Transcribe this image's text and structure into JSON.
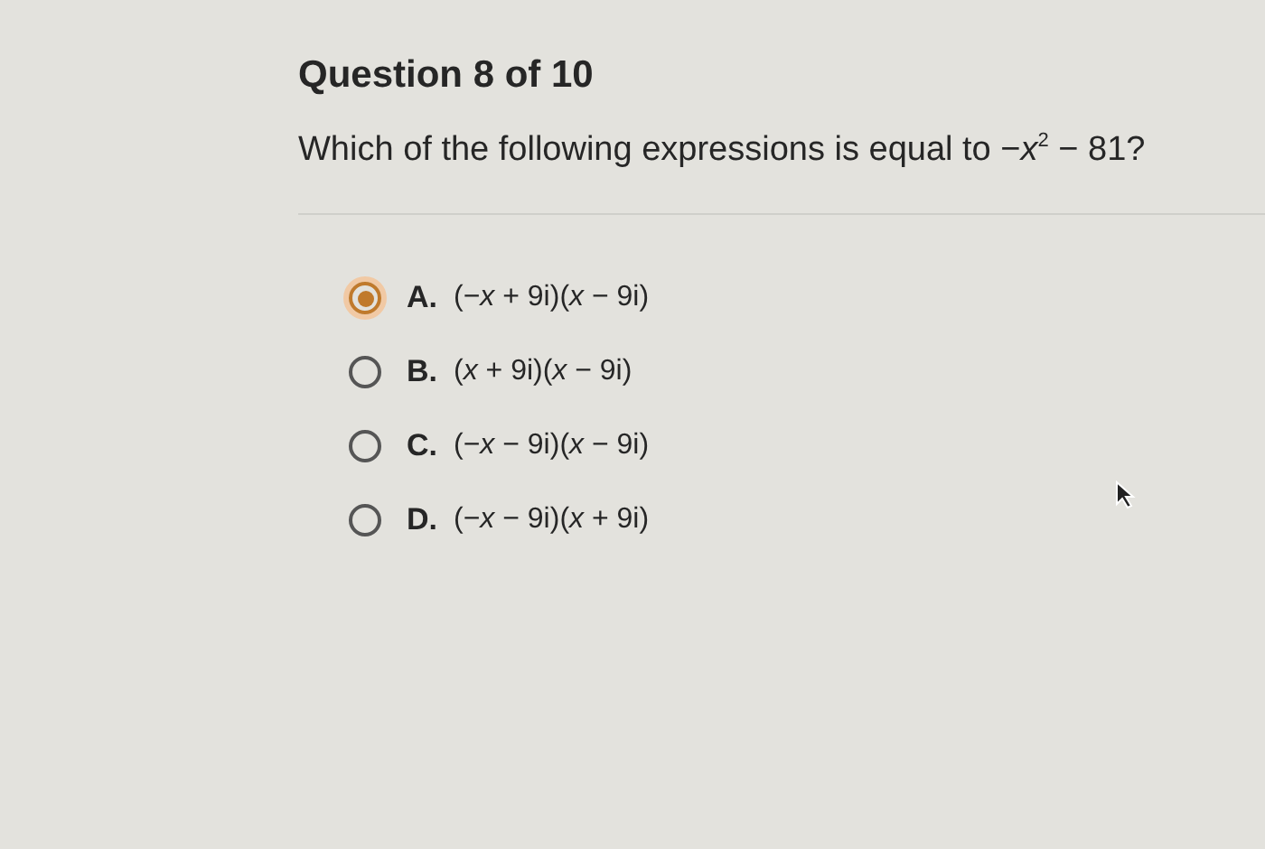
{
  "question": {
    "title": "Question 8 of 10",
    "prompt": "Which of the following expressions is equal to −*x*$^{2}$ − 81?"
  },
  "options": [
    {
      "letter": "A.",
      "text": "(−*x* + 9i)(*x* − 9i)",
      "selected": true
    },
    {
      "letter": "B.",
      "text": "(*x* + 9i)(*x* − 9i)",
      "selected": false
    },
    {
      "letter": "C.",
      "text": "(−*x* − 9i)(*x* − 9i)",
      "selected": false
    },
    {
      "letter": "D.",
      "text": "(−*x* − 9i)(*x* + 9i)",
      "selected": false
    }
  ]
}
